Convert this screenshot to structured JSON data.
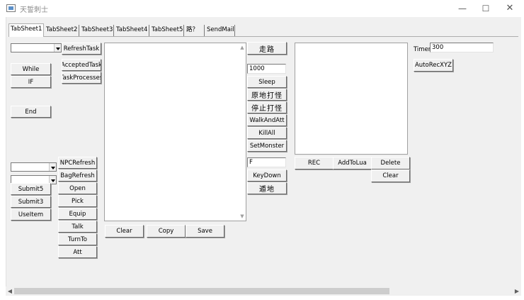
{
  "window": {
    "title": "天誓刺士",
    "minimize_glyph": "—",
    "maximize_glyph": "☐",
    "close_glyph": "✕",
    "icon": "app-window-icon"
  },
  "tabs": [
    {
      "label": "TabSheet1",
      "active": true
    },
    {
      "label": "TabSheet2"
    },
    {
      "label": "TabSheet3"
    },
    {
      "label": "TabSheet4"
    },
    {
      "label": "TabSheet5"
    },
    {
      "label": "路？"
    },
    {
      "label": "SendMail"
    }
  ],
  "left": {
    "task_combo_value": "",
    "refresh_task": "RefreshTask",
    "while": "While",
    "if": "IF",
    "accepted_task": "AcceptedTask",
    "task_processes": "TaskProcesses",
    "end": "End",
    "combo1_value": "",
    "combo2_value": "",
    "submit5": "Submit5",
    "submit3": "Submit3",
    "use_item": "UseItem",
    "npc_refresh": "NPCRefresh",
    "bag_refresh": "BagRefresh",
    "open": "Open",
    "pick": "Pick",
    "equip": "Equip",
    "talk": "Talk",
    "turn_to": "TurnTo",
    "att": "Att"
  },
  "memo": {
    "text": "",
    "clear": "Clear",
    "copy": "Copy",
    "save": "Save",
    "scroll_up": "▲",
    "scroll_down": "▼"
  },
  "middle": {
    "walk": "走路",
    "value_field": "1000",
    "sleep": "Sleep",
    "attack_in_place": "原地打怪",
    "stop_attack": "停止打怪",
    "walk_and_att": "WalkAndAtt",
    "kill_all": "KillAll",
    "set_monster": "SetMonster",
    "key_field": "F",
    "key_down": "KeyDown",
    "teleport": "遁地"
  },
  "right": {
    "list_text": "",
    "rec": "REC",
    "add_to_lua": "AddToLua",
    "delete": "Delete",
    "clear": "Clear",
    "timer_label": "Timer:",
    "timer_value": "300",
    "auto_rec_xyz": "AutoRecXYZ"
  },
  "hscroll": {
    "left": "◀",
    "right": "▶"
  }
}
